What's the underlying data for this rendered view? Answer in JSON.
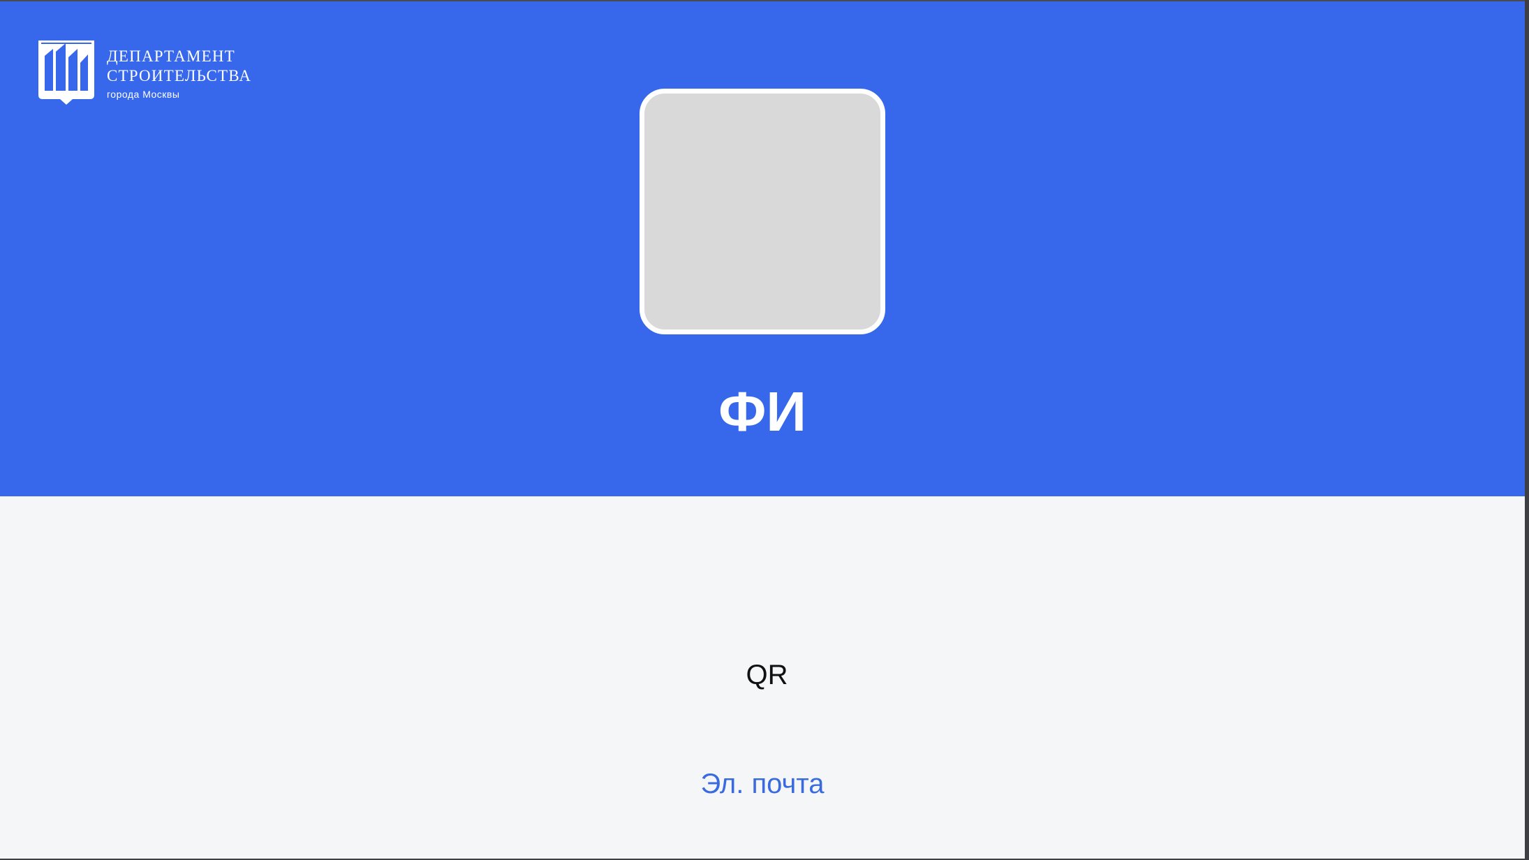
{
  "logo": {
    "icon": "building-emblem-icon",
    "line1": "ДЕПАРТАМЕНТ",
    "line2": "СТРОИТЕЛЬСТВА",
    "line3": "города Москвы"
  },
  "profile": {
    "photo": "photo-placeholder",
    "name": "ФИ",
    "qr_label": "QR",
    "email_label": "Эл. почта"
  },
  "colors": {
    "header_background": "#3768ec",
    "page_background": "#f5f6f8",
    "photo_placeholder": "#d9d9d9",
    "email_link": "#3a6bde"
  }
}
